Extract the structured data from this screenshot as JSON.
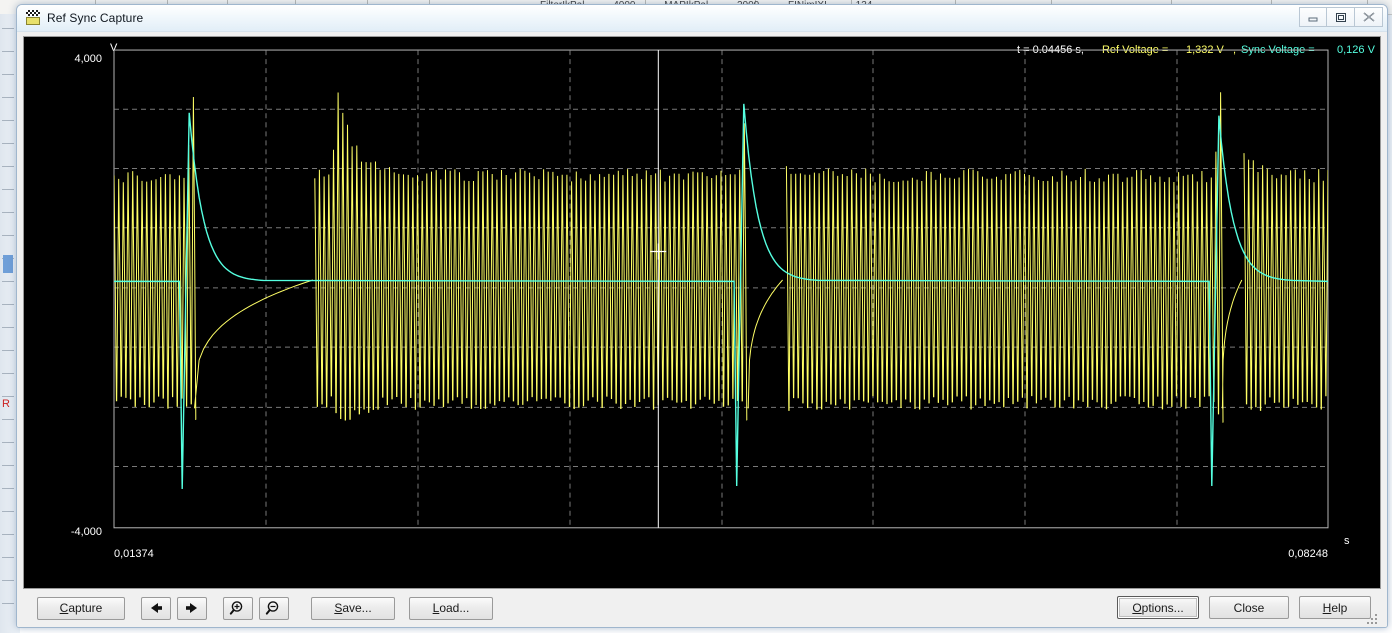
{
  "window": {
    "title": "Ref Sync Capture",
    "icon": "capture-flag-icon",
    "controls": {
      "minimize": "minimize-icon",
      "maximize": "maximize-icon",
      "close": "close-icon"
    }
  },
  "background": {
    "strip_labels": [
      "FilterIkPal",
      "MAPIkPal",
      "FINimIXI"
    ],
    "counts": [
      "4000",
      "2000",
      "134"
    ]
  },
  "readout": {
    "time_label": "t = 0.04456 s,",
    "ref_label": "Ref Voltage =",
    "ref_value": "1,332 V",
    "sep": ",",
    "sync_label": "Sync Voltage =",
    "sync_value": "0,126 V",
    "colors": {
      "time": "#ffffff",
      "ref": "#ffff66",
      "sync": "#55ffe0"
    }
  },
  "axes": {
    "y_unit": "V",
    "y_max": "4,000",
    "y_min": "-4,000",
    "x_unit": "s",
    "x_min": "0,01374",
    "x_max": "0,08248"
  },
  "toolbar": {
    "capture": "Capture",
    "capture_accel": "C",
    "prev": "prev-arrow-icon",
    "next": "next-arrow-icon",
    "zoom_in": "zoom-in-icon",
    "zoom_out": "zoom-out-icon",
    "save": "Save...",
    "save_accel": "S",
    "load": "Load...",
    "load_accel": "L",
    "options": "Options...",
    "options_accel": "O",
    "close": "Close",
    "help": "Help",
    "help_accel": "H"
  },
  "chart_data": {
    "type": "line",
    "title": "Ref Sync Capture",
    "xlabel": "s",
    "ylabel": "V",
    "xlim": [
      0.01374,
      0.08248
    ],
    "ylim": [
      -4.0,
      4.0
    ],
    "grid": true,
    "grid_style": "dashed",
    "grid_color": "#909090",
    "background": "#000000",
    "frame_color": "#b0b0b0",
    "x_gridlines": [
      0.02233,
      0.03092,
      0.03951,
      0.0481,
      0.05669,
      0.06528,
      0.07387
    ],
    "y_gridlines": [
      3.0,
      2.0,
      1.0,
      0.0,
      -1.0,
      -2.0,
      -3.0
    ],
    "cursor": {
      "x": 0.04456,
      "ref_y": 1.332,
      "sync_y": 0.126,
      "line_color": "#ffffff"
    },
    "series": [
      {
        "name": "Ref Voltage",
        "color": "#ffff66",
        "description": "High-frequency square/sawtooth oscillation, amplitude approx +1.9 V to -1.9 V, period approx 0.00026 s, with three large transient excursions reaching +3.4 V",
        "amplitude_high": 1.9,
        "amplitude_low": -1.9,
        "cycles": 260,
        "transients": [
          {
            "x": 0.0182,
            "peak": 3.2,
            "type": "spike-with-decay"
          },
          {
            "x": 0.0264,
            "peak": 3.4,
            "type": "spike-with-decay"
          },
          {
            "x": 0.0496,
            "peak": 3.45,
            "type": "spike-with-decay"
          },
          {
            "x": 0.0764,
            "peak": 3.3,
            "type": "spike-with-decay"
          }
        ]
      },
      {
        "name": "Sync Voltage",
        "color": "#55ffe0",
        "description": "Near-zero baseline at 0.126 V with three bipolar sync pulses spanning approx +2.9 V to -3.3 V and exponential decay back to baseline",
        "baseline": 0.126,
        "pulses": [
          {
            "x": 0.0179,
            "max": 2.95,
            "min": -3.35
          },
          {
            "x": 0.0493,
            "max": 3.1,
            "min": -3.3
          },
          {
            "x": 0.0762,
            "max": 2.9,
            "min": -3.3
          }
        ]
      }
    ]
  }
}
